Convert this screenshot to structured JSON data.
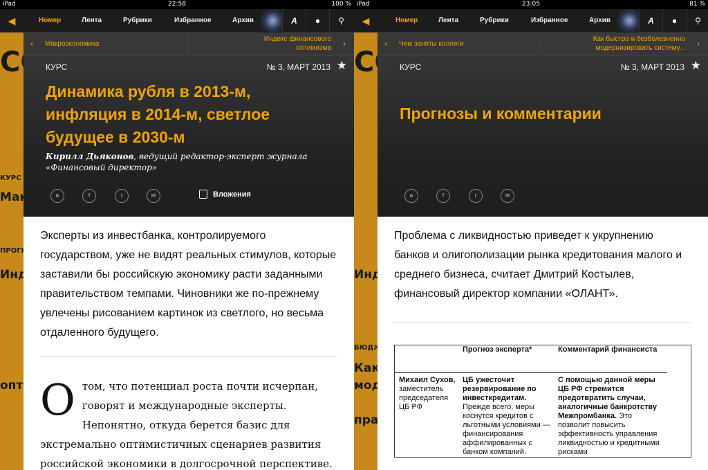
{
  "left": {
    "status": {
      "carrier": "iPad",
      "time": "22:58",
      "battery": "100 %"
    },
    "nav": {
      "tabs": [
        "Номер",
        "Лента",
        "Рубрики",
        "Избранное",
        "Архив"
      ],
      "font_icon": "A"
    },
    "subnav": {
      "prev": "Макроэкономика",
      "next_line1": "Индекс финансового",
      "next_line2": "оптимизма"
    },
    "rubric": "КУРС",
    "issue": "№ 3, МАРТ 2013",
    "title_lines": [
      "Динамика рубля в 2013-м,",
      "инфляция в 2014-м, светлое",
      "будущее в 2030-м"
    ],
    "author_name": "Кирилл Дьяконов",
    "author_role": ", ведущий редактор-эксперт журнала «Финансовый директор»",
    "socials": [
      "в",
      "f",
      "t",
      "✉"
    ],
    "attachments": "Вложения",
    "lead": "Эксперты из инвестбанка, контролируемого государством, уже не видят реальных стимулов, которые заставили бы российскую экономику расти заданными правительством темпами. Чиновники же по-прежнему увлечены рисованием картинок из светлого, но весьма отдаленного будущего.",
    "dropcap": "О",
    "body_text": "том, что потенциал роста почти исчерпан, говорят и международные эксперты. Непонятно, откуда берется базис для экстремально оптимистичных сценариев развития российской экономики в долгосрочной перспективе."
  },
  "right": {
    "status": {
      "carrier": "iPad",
      "time": "23:05",
      "battery": "81 %"
    },
    "nav": {
      "tabs": [
        "Номер",
        "Лента",
        "Рубрики",
        "Избранное",
        "Архив"
      ],
      "font_icon": "A"
    },
    "subnav": {
      "prev": "Чем заняты коллеги",
      "next_line1": "Как быстро и безболезненно",
      "next_line2": "модернизировать систему..."
    },
    "rubric": "КУРС",
    "issue": "№ 3, МАРТ 2013",
    "title": "Прогнозы и комментарии",
    "socials": [
      "в",
      "f",
      "t",
      "✉"
    ],
    "lead": "Проблема с ликвидностью приведет к укрупнению банков и олигополизации рынка кредитования малого и среднего бизнеса, считает Дмитрий Костылев, финансовый директор компании «ОЛАНТ».",
    "table": {
      "headers": [
        "",
        "Прогноз эксперта*",
        "Комментарий финансиста"
      ],
      "row": {
        "person_name": "Михаил Сухов,",
        "person_role": "заместитель председателя ЦБ РФ",
        "forecast_bold": "ЦБ ужесточит резервирование по инвесткредитам.",
        "forecast_text": "Прежде всего, меры коснутся кредитов с льготными условиями — финансирования аффилированных с банком компаний.",
        "comment_bold": "С помощью данной меры ЦБ РФ стремится предотвратить случаи, аналогичные банкротству Межпромбанка.",
        "comment_text": "Это позволит повысить эффективность управления ликвидностью и кредитными рисками"
      }
    }
  },
  "background_cover_text": [
    "СОДЕРЖ",
    "КУРС",
    "Макр",
    "ПРОГН",
    "Инде",
    "опти",
    "БЮДЖЕ",
    "Как",
    "моде",
    "прак"
  ],
  "colors": {
    "accent": "#f0a500",
    "nav": "#1c1c1c",
    "cover": "#c78a1a"
  }
}
